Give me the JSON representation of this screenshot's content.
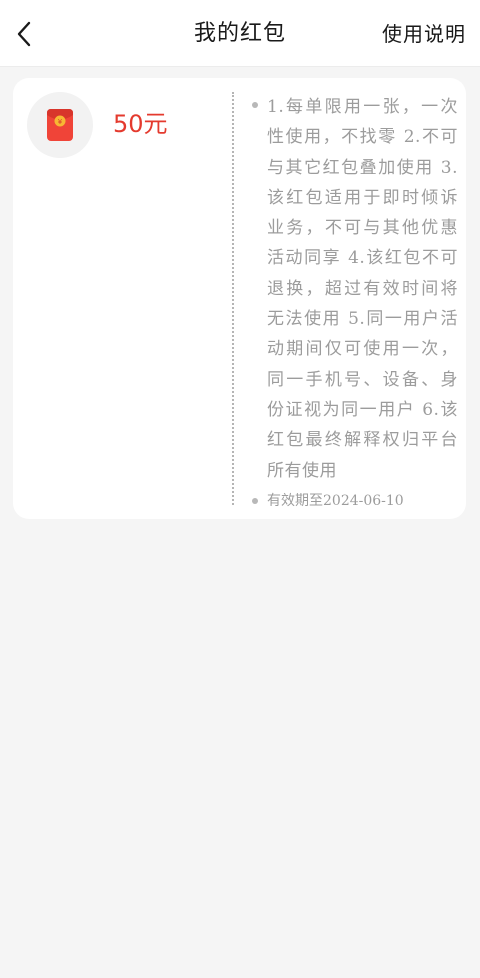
{
  "header": {
    "title": "我的红包",
    "instructions_label": "使用说明"
  },
  "coupon": {
    "amount": "50元",
    "rules": "1.每单限用一张，一次性使用，不找零 2.不可与其它红包叠加使用 3.该红包适用于即时倾诉业务，不可与其他优惠活动同享 4.该红包不可退换，超过有效时间将无法使用 5.同一用户活动期间仅可使用一次，同一手机号、设备、身份证视为同一用户 6.该红包最终解释权归平台所有使用",
    "validity": "有效期至2024-06-10"
  },
  "colors": {
    "accent_red": "#e43a2e",
    "envelope_red": "#f04438",
    "coin_yellow": "#f7b733"
  },
  "icons": {
    "back": "chevron-left-icon",
    "coupon": "red-envelope-icon"
  }
}
